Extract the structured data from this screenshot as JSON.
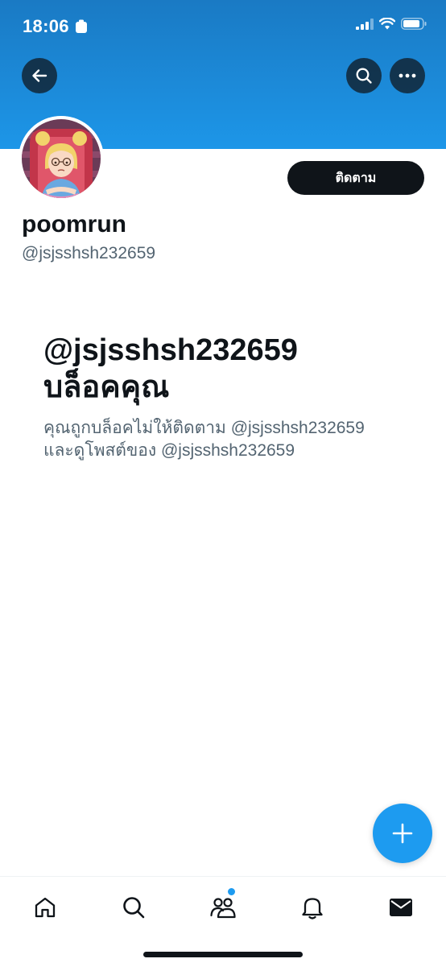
{
  "status_bar": {
    "time": "18:06"
  },
  "header": {
    "back_icon": "arrow-left-icon",
    "search_icon": "search-icon",
    "more_icon": "more-horizontal-icon",
    "banner_color": "#1d96e8"
  },
  "profile": {
    "display_name": "poomrun",
    "handle": "@jsjsshsh232659",
    "follow_label": "ติดตาม"
  },
  "blocked_notice": {
    "title_line1": "@jsjsshsh232659",
    "title_line2": "บล็อคคุณ",
    "description_line1": "คุณถูกบล็อคไม่ให้ติดตาม @jsjsshsh232659",
    "description_line2": "และดูโพสต์ของ @jsjsshsh232659"
  },
  "compose": {
    "icon": "plus-icon",
    "color": "#1d9bf0"
  },
  "tab_bar": {
    "items": [
      {
        "name": "home",
        "icon": "home-icon"
      },
      {
        "name": "search",
        "icon": "search-icon"
      },
      {
        "name": "communities",
        "icon": "communities-icon",
        "has_badge": true
      },
      {
        "name": "notifications",
        "icon": "bell-icon"
      },
      {
        "name": "messages",
        "icon": "envelope-icon"
      }
    ]
  }
}
